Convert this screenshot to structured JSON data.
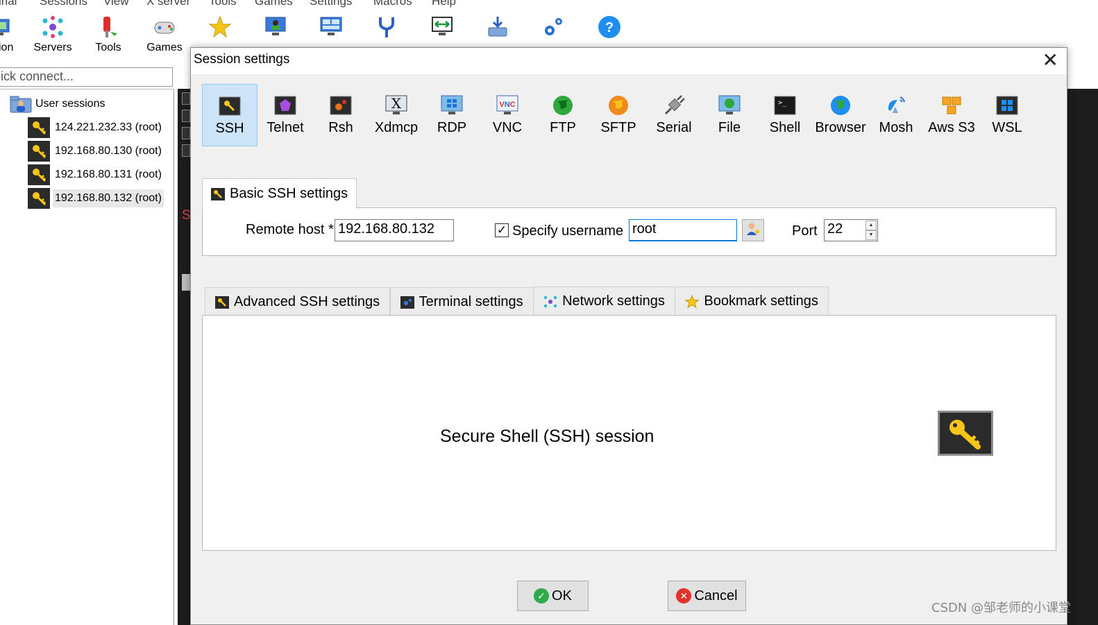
{
  "menubar": {
    "items": [
      "inal",
      "Sessions",
      "View",
      "X server",
      "Tools",
      "Games",
      "Settings",
      "Macros",
      "Help"
    ]
  },
  "toolbar": {
    "items": [
      {
        "label": "ion",
        "icon": "session-icon"
      },
      {
        "label": "Servers",
        "icon": "servers-icon"
      },
      {
        "label": "Tools",
        "icon": "tools-icon"
      },
      {
        "label": "Games",
        "icon": "gamepad-icon"
      },
      {
        "label": "",
        "icon": "star-icon"
      },
      {
        "label": "",
        "icon": "monitor-icon"
      },
      {
        "label": "",
        "icon": "split-icon"
      },
      {
        "label": "",
        "icon": "fork-icon"
      },
      {
        "label": "",
        "icon": "tunnel-icon"
      },
      {
        "label": "",
        "icon": "download-icon"
      },
      {
        "label": "",
        "icon": "gears-icon"
      },
      {
        "label": "",
        "icon": "help-icon"
      }
    ]
  },
  "quick_connect": {
    "placeholder": "ick connect..."
  },
  "sidebar": {
    "root_label": "User sessions",
    "sessions": [
      {
        "label": "124.221.232.33 (root)",
        "selected": false
      },
      {
        "label": "192.168.80.130 (root)",
        "selected": false
      },
      {
        "label": "192.168.80.131 (root)",
        "selected": false
      },
      {
        "label": "192.168.80.132 (root)",
        "selected": true
      }
    ]
  },
  "terminal": {
    "partial_text": "S"
  },
  "dialog": {
    "title": "Session settings",
    "close_glyph": "✕",
    "session_types": [
      {
        "label": "SSH",
        "icon": "ssh-key-icon",
        "selected": true
      },
      {
        "label": "Telnet",
        "icon": "telnet-icon",
        "selected": false
      },
      {
        "label": "Rsh",
        "icon": "rsh-icon",
        "selected": false
      },
      {
        "label": "Xdmcp",
        "icon": "xdmcp-icon",
        "selected": false
      },
      {
        "label": "RDP",
        "icon": "rdp-icon",
        "selected": false
      },
      {
        "label": "VNC",
        "icon": "vnc-icon",
        "selected": false
      },
      {
        "label": "FTP",
        "icon": "ftp-globe-icon",
        "selected": false
      },
      {
        "label": "SFTP",
        "icon": "sftp-globe-icon",
        "selected": false
      },
      {
        "label": "Serial",
        "icon": "serial-plug-icon",
        "selected": false
      },
      {
        "label": "File",
        "icon": "file-monitor-icon",
        "selected": false
      },
      {
        "label": "Shell",
        "icon": "shell-icon",
        "selected": false
      },
      {
        "label": "Browser",
        "icon": "browser-globe-icon",
        "selected": false
      },
      {
        "label": "Mosh",
        "icon": "mosh-satellite-icon",
        "selected": false
      },
      {
        "label": "Aws S3",
        "icon": "aws-cubes-icon",
        "selected": false
      },
      {
        "label": "WSL",
        "icon": "windows-icon",
        "selected": false
      }
    ],
    "basic_tab_label": "Basic SSH settings",
    "remote_host_label": "Remote host *",
    "remote_host_value": "192.168.80.132",
    "specify_username_label": "Specify username",
    "specify_username_checked": true,
    "username_value": "root",
    "port_label": "Port",
    "port_value": "22",
    "adv_tabs": [
      {
        "label": "Advanced SSH settings",
        "icon": "key-icon"
      },
      {
        "label": "Terminal settings",
        "icon": "terminal-icon"
      },
      {
        "label": "Network settings",
        "icon": "network-icon"
      },
      {
        "label": "Bookmark settings",
        "icon": "star-icon"
      }
    ],
    "description": "Secure Shell (SSH) session",
    "ok_label": "OK",
    "cancel_label": "Cancel"
  },
  "watermark": "CSDN @邹老师的小课堂",
  "colors": {
    "selection_bg": "#cce4f7",
    "dialog_bg": "#f0f0f0",
    "terminal_bg": "#1c1c1c",
    "key_yellow": "#f5c518",
    "ok_green": "#2eaa4a",
    "cancel_red": "#e2322b"
  }
}
